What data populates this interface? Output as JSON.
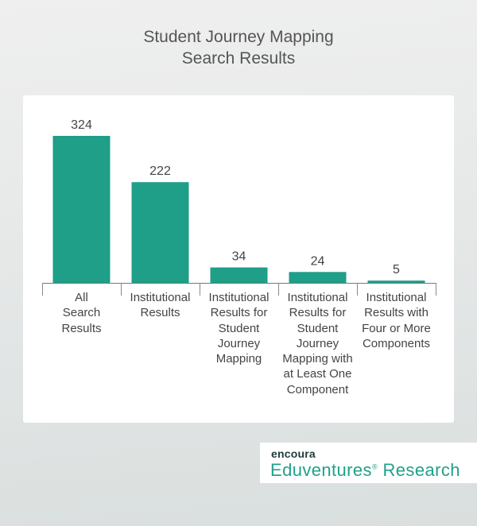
{
  "chart_data": {
    "type": "bar",
    "title": "Student Journey Mapping Search Results",
    "title_lines": [
      "Student Journey Mapping",
      "Search Results"
    ],
    "categories": [
      "All Search Results",
      "Institutional Results",
      "Institutional Results for Student Journey Mapping",
      "Institutional Results for Student Journey Mapping with at Least One Component",
      "Institutional Results with Four or More Components"
    ],
    "category_lines": [
      [
        "All",
        "Search",
        "Results"
      ],
      [
        "Institutional",
        "Results"
      ],
      [
        "Institutional",
        "Results for",
        "Student",
        "Journey",
        "Mapping"
      ],
      [
        "Institutional",
        "Results for",
        "Student",
        "Journey",
        "Mapping with",
        "at Least One",
        "Component"
      ],
      [
        "Institutional",
        "Results with",
        "Four or More",
        "Components"
      ]
    ],
    "values": [
      324,
      222,
      34,
      24,
      5
    ],
    "data_labels": [
      "324",
      "222",
      "34",
      "24",
      "5"
    ],
    "xlabel": "",
    "ylabel": "",
    "ylim": [
      0,
      324
    ],
    "grid": false,
    "legend": "none",
    "bar_color": "#1f9e88"
  },
  "branding": {
    "brand": "encoura",
    "product": "Eduventures",
    "product_suffix": "Research",
    "mark": "®"
  }
}
